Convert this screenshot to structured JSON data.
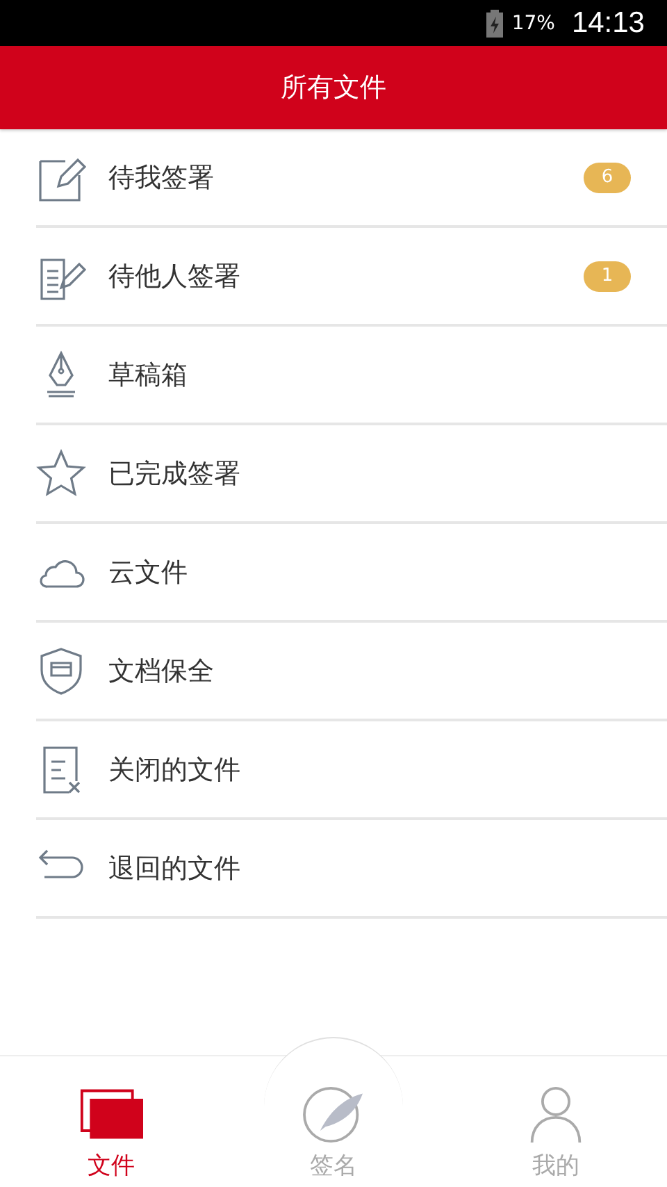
{
  "status_bar": {
    "battery": "17%",
    "time": "14:13"
  },
  "header": {
    "title": "所有文件"
  },
  "items": [
    {
      "kind": "edit",
      "label": "待我签署",
      "badge": "6"
    },
    {
      "kind": "docedit",
      "label": "待他人签署",
      "badge": "1"
    },
    {
      "kind": "pen",
      "label": "草稿箱"
    },
    {
      "kind": "star",
      "label": "已完成签署"
    },
    {
      "kind": "cloud",
      "label": "云文件"
    },
    {
      "kind": "shield",
      "label": "文档保全"
    },
    {
      "kind": "docx",
      "label": "关闭的文件"
    },
    {
      "kind": "return",
      "label": "退回的文件"
    }
  ],
  "tabs": [
    {
      "kind": "files",
      "label": "文件",
      "selected": true
    },
    {
      "kind": "sign",
      "label": "签名",
      "selected": false
    },
    {
      "kind": "person",
      "label": "我的",
      "selected": false
    }
  ]
}
